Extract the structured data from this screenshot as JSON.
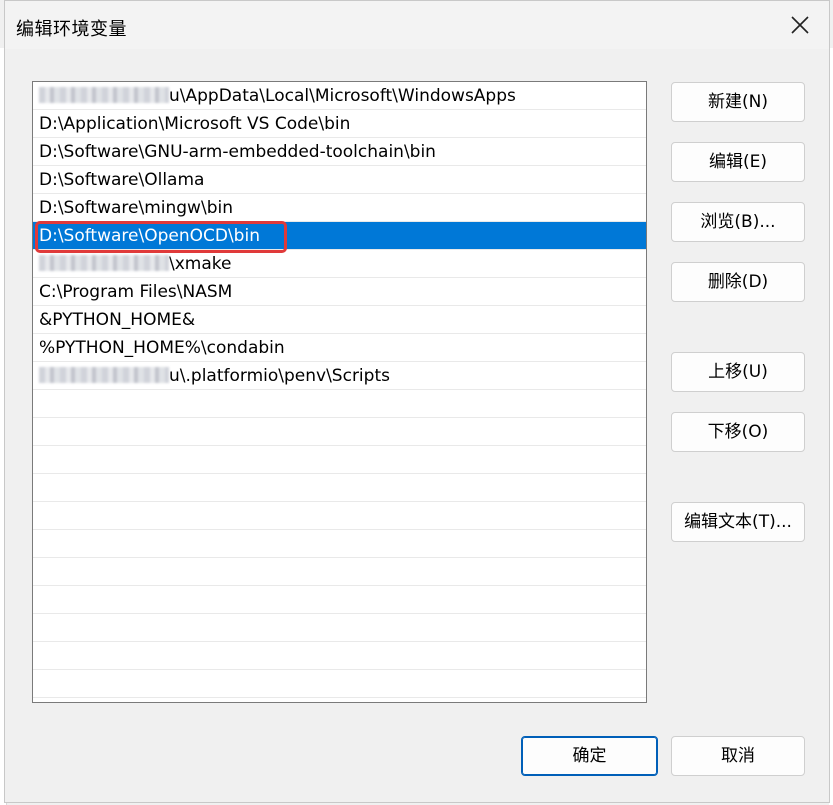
{
  "window": {
    "title": "编辑环境变量"
  },
  "entries": [
    {
      "blurred_prefix": true,
      "text": "u\\AppData\\Local\\Microsoft\\WindowsApps",
      "selected": false
    },
    {
      "blurred_prefix": false,
      "text": "D:\\Application\\Microsoft VS Code\\bin",
      "selected": false
    },
    {
      "blurred_prefix": false,
      "text": "D:\\Software\\GNU-arm-embedded-toolchain\\bin",
      "selected": false
    },
    {
      "blurred_prefix": false,
      "text": "D:\\Software\\Ollama",
      "selected": false
    },
    {
      "blurred_prefix": false,
      "text": "D:\\Software\\mingw\\bin",
      "selected": false
    },
    {
      "blurred_prefix": false,
      "text": "D:\\Software\\OpenOCD\\bin",
      "selected": true
    },
    {
      "blurred_prefix": true,
      "text": "\\xmake",
      "selected": false
    },
    {
      "blurred_prefix": false,
      "text": "C:\\Program Files\\NASM",
      "selected": false
    },
    {
      "blurred_prefix": false,
      "text": "&PYTHON_HOME&",
      "selected": false
    },
    {
      "blurred_prefix": false,
      "text": "%PYTHON_HOME%\\condabin",
      "selected": false
    },
    {
      "blurred_prefix": true,
      "text": "u\\.platformio\\penv\\Scripts",
      "selected": false
    }
  ],
  "buttons": {
    "new": "新建(N)",
    "edit": "编辑(E)",
    "browse": "浏览(B)...",
    "delete": "删除(D)",
    "move_up": "上移(U)",
    "move_down": "下移(O)",
    "edit_text": "编辑文本(T)...",
    "ok": "确定",
    "cancel": "取消"
  },
  "colors": {
    "selection": "#0078d7",
    "highlight_border": "#e03a3a",
    "ok_border": "#005fb8"
  },
  "icons": {
    "close": "close-icon"
  }
}
